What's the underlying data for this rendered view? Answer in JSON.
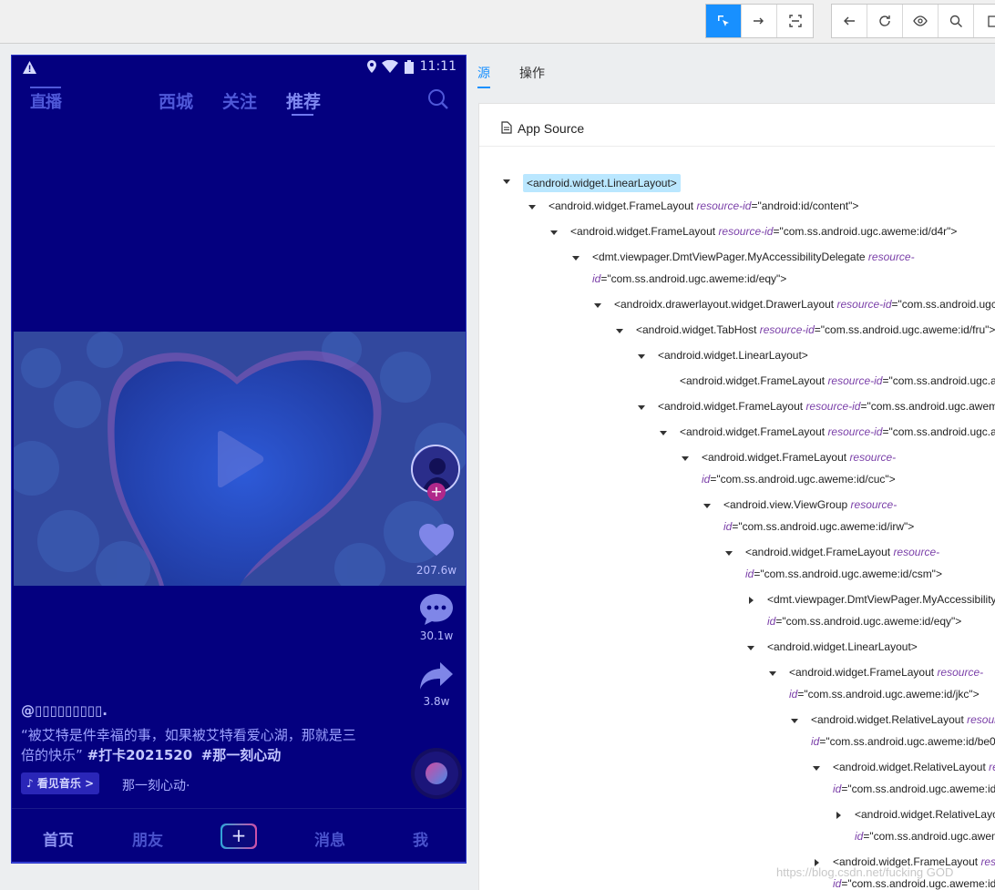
{
  "toolbar": {
    "group1": [
      {
        "icon": "select-element-icon",
        "active": true
      },
      {
        "icon": "swipe-arrow-icon",
        "active": false
      },
      {
        "icon": "tap-coordinates-icon",
        "active": false
      }
    ],
    "group2": [
      {
        "icon": "back-icon"
      },
      {
        "icon": "refresh-icon"
      },
      {
        "icon": "eye-icon"
      },
      {
        "icon": "search-icon"
      },
      {
        "icon": "copy-icon"
      }
    ]
  },
  "device": {
    "status": {
      "time": "11:11"
    },
    "topnav": {
      "live_label": "直播",
      "tabs": [
        {
          "label": "西城",
          "active": false
        },
        {
          "label": "关注",
          "active": false
        },
        {
          "label": "推荐",
          "active": true
        }
      ]
    },
    "side": {
      "like_count": "207.6w",
      "comment_count": "30.1w",
      "share_count": "3.8w"
    },
    "post": {
      "author": "@▯▯▯▯▯▯▯▯▯.",
      "desc_line1": "“被艾特是件幸福的事，如果被艾特看爱心湖，那就是三",
      "desc_line2_text": "倍的快乐” ",
      "hashtag1": "#打卡2021520",
      "hashtag2": "#那一刻心动",
      "music_tag": "♪ 看见音乐 >",
      "music_name": "那一刻心动·"
    },
    "bottom_nav": [
      {
        "label": "首页",
        "active": true
      },
      {
        "label": "朋友",
        "active": false
      },
      {
        "label": "消息",
        "active": false
      },
      {
        "label": "我",
        "active": false
      }
    ],
    "accent": "#04007f"
  },
  "panel": {
    "tabs": [
      {
        "label": "源",
        "active": true
      },
      {
        "label": "操作",
        "active": false
      }
    ],
    "source_title": "App Source"
  },
  "tree": [
    {
      "tag": "<android.widget.LinearLayout>",
      "selected": true
    },
    {
      "tag": "<android.widget.FrameLayout ",
      "attr": "resource-id",
      "val": "=\"android:id/content\">"
    },
    {
      "tag": "<android.widget.FrameLayout ",
      "attr": "resource-id",
      "val": "=\"com.ss.android.ugc.aweme:id/d4r\">"
    },
    {
      "tag": "<dmt.viewpager.DmtViewPager.MyAccessibilityDelegate ",
      "attr": "resource-",
      "line2attr": "id",
      "line2val": "=\"com.ss.android.ugc.aweme:id/eqy\">"
    },
    {
      "tag": "<androidx.drawerlayout.widget.DrawerLayout ",
      "attr": "resource-id",
      "val": "=\"com.ss.android.ugc."
    },
    {
      "tag": "<android.widget.TabHost ",
      "attr": "resource-id",
      "val": "=\"com.ss.android.ugc.aweme:id/fru\">"
    },
    {
      "tag": "<android.widget.LinearLayout>"
    },
    {
      "tag": "<android.widget.FrameLayout ",
      "attr": "resource-id",
      "val": "=\"com.ss.android.ugc.a"
    },
    {
      "tag": "<android.widget.FrameLayout ",
      "attr": "resource-id",
      "val": "=\"com.ss.android.ugc.aweme"
    },
    {
      "tag": "<android.widget.FrameLayout ",
      "attr": "resource-id",
      "val": "=\"com.ss.android.ugc.a"
    },
    {
      "tag": "<android.widget.FrameLayout ",
      "attr": "resource-",
      "line2attr": "id",
      "line2val": "=\"com.ss.android.ugc.aweme:id/cuc\">"
    },
    {
      "tag": "<android.view.ViewGroup ",
      "attr": "resource-",
      "line2attr": "id",
      "line2val": "=\"com.ss.android.ugc.aweme:id/irw\">"
    },
    {
      "tag": "<android.widget.FrameLayout ",
      "attr": "resource-",
      "line2attr": "id",
      "line2val": "=\"com.ss.android.ugc.aweme:id/csm\">"
    },
    {
      "tag": "<dmt.viewpager.DmtViewPager.MyAccessibility",
      "line2attr": "id",
      "line2val": "=\"com.ss.android.ugc.aweme:id/eqy\">"
    },
    {
      "tag": "<android.widget.LinearLayout>"
    },
    {
      "tag": "<android.widget.FrameLayout ",
      "attr": "resource-",
      "line2attr": "id",
      "line2val": "=\"com.ss.android.ugc.aweme:id/jkc\">"
    },
    {
      "tag": "<android.widget.RelativeLayout ",
      "attr": "resour",
      "line2attr": "id",
      "line2val": "=\"com.ss.android.ugc.aweme:id/be0"
    },
    {
      "tag": "<android.widget.RelativeLayout ",
      "attr": "re",
      "line2attr": "id",
      "line2val": "=\"com.ss.android.ugc.aweme:id/"
    },
    {
      "tag": "<android.widget.RelativeLayo",
      "line2attr": "id",
      "line2val": "=\"com.ss.android.ugc.awem"
    },
    {
      "tag": "<android.widget.FrameLayout ",
      "attr": "res",
      "line2attr": "id",
      "line2val": "=\"com.ss.android.ugc.aweme:id/"
    }
  ],
  "watermark": "https://blog.csdn.net/fucking GOD"
}
